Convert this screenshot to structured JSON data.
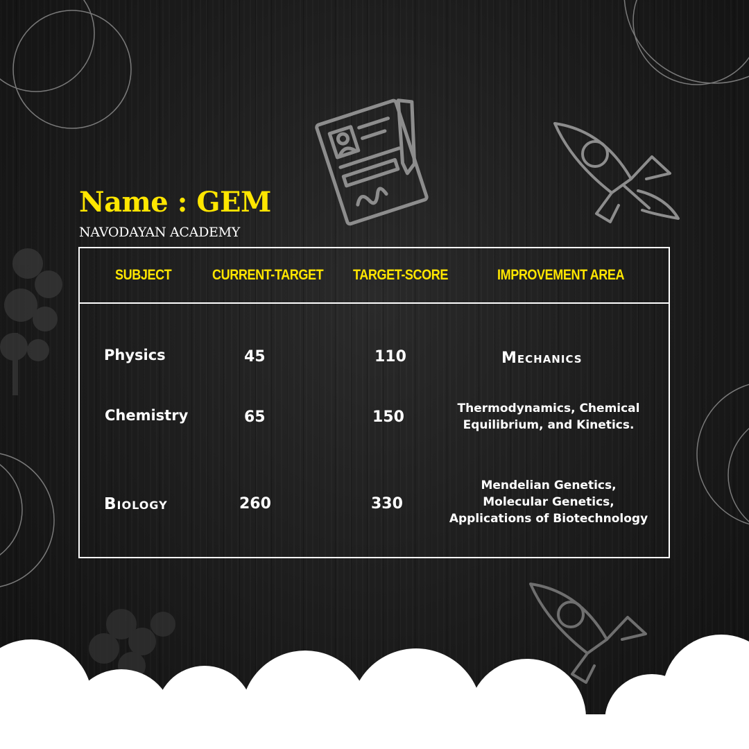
{
  "header": {
    "name_label": "Name : GEM",
    "academy": "NAVODAYAN ACADEMY"
  },
  "table": {
    "columns": [
      "SUBJECT",
      "CURRENT-TARGET",
      "TARGET-SCORE",
      "IMPROVEMENT AREA"
    ],
    "rows": [
      {
        "subject": "Physics",
        "current": "45",
        "target": "110",
        "area": "Mechanics"
      },
      {
        "subject": "Chemistry",
        "current": "65",
        "target": "150",
        "area": "Thermodynamics, Chemical\nEquilibrium, and Kinetics."
      },
      {
        "subject": "Biology",
        "current": "260",
        "target": "330",
        "area": "Mendelian Genetics,\nMolecular Genetics,\nApplications of Biotechnology"
      }
    ]
  },
  "icons": [
    "document-icon",
    "rocket-icon",
    "rocket-icon",
    "tree-icon",
    "tree-icon"
  ],
  "colors": {
    "accent": "#ffe600",
    "text": "#ffffff",
    "background": "#171717"
  }
}
